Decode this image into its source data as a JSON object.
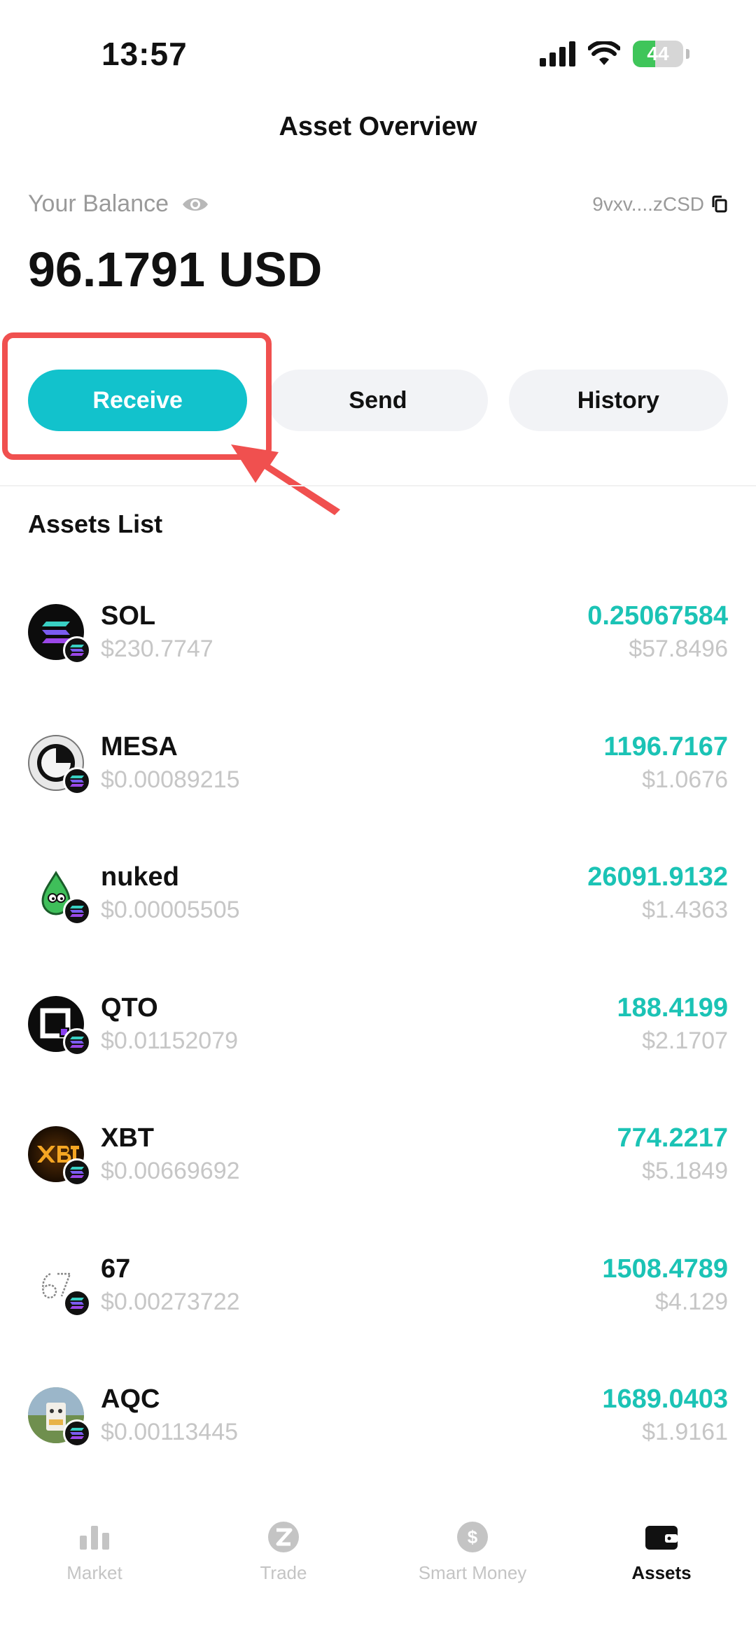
{
  "status_bar": {
    "time": "13:57",
    "battery": "44",
    "battery_level": 0.44
  },
  "header": {
    "title": "Asset Overview"
  },
  "balance": {
    "label": "Your Balance",
    "value": "96.1791 USD",
    "address": "9vxv....zCSD"
  },
  "actions": {
    "receive": "Receive",
    "send": "Send",
    "history": "History"
  },
  "assets": {
    "title": "Assets List",
    "items": [
      {
        "symbol": "SOL",
        "price": "$230.7747",
        "amount": "0.25067584",
        "value": "$57.8496",
        "icon": "sol-icon"
      },
      {
        "symbol": "MESA",
        "price": "$0.00089215",
        "amount": "1196.7167",
        "value": "$1.0676",
        "icon": "mesa-icon"
      },
      {
        "symbol": "nuked",
        "price": "$0.00005505",
        "amount": "26091.9132",
        "value": "$1.4363",
        "icon": "nuked-icon"
      },
      {
        "symbol": "QTO",
        "price": "$0.01152079",
        "amount": "188.4199",
        "value": "$2.1707",
        "icon": "qto-icon"
      },
      {
        "symbol": "XBT",
        "price": "$0.00669692",
        "amount": "774.2217",
        "value": "$5.1849",
        "icon": "xbt-icon"
      },
      {
        "symbol": "67",
        "price": "$0.00273722",
        "amount": "1508.4789",
        "value": "$4.129",
        "icon": "sixty-seven-icon"
      },
      {
        "symbol": "AQC",
        "price": "$0.00113445",
        "amount": "1689.0403",
        "value": "$1.9161",
        "icon": "aqc-icon"
      }
    ]
  },
  "tabs": [
    {
      "label": "Market",
      "icon": "bar-chart-icon"
    },
    {
      "label": "Trade",
      "icon": "trade-z-icon"
    },
    {
      "label": "Smart Money",
      "icon": "dollar-icon"
    },
    {
      "label": "Assets",
      "icon": "wallet-icon",
      "active": true
    }
  ],
  "colors": {
    "accent": "#12c2cc",
    "amount_green": "#1bc3b5",
    "highlight_red": "#f0504f"
  }
}
